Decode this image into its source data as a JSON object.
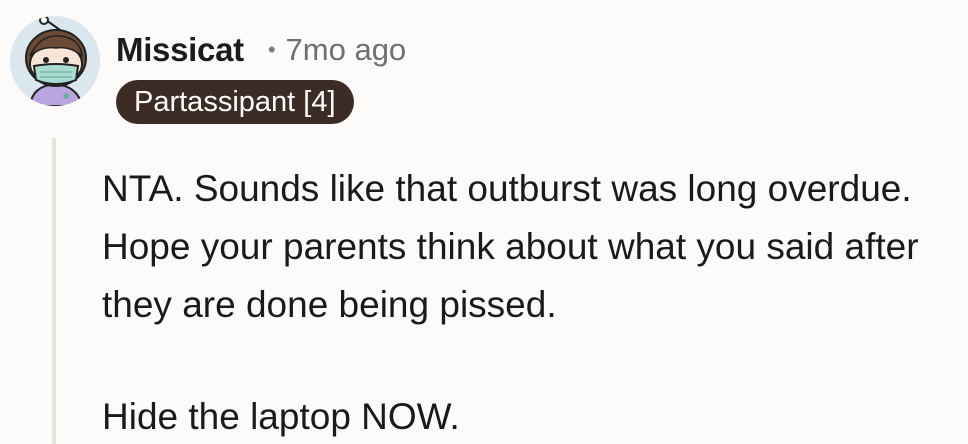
{
  "comment": {
    "author": "Missicat",
    "separator": "•",
    "timestamp": "7mo ago",
    "flair": "Partassipant [4]",
    "paragraphs": [
      "NTA. Sounds like that outburst was long overdue. Hope your parents think about what you said after they are done being pissed.",
      "Hide the laptop NOW."
    ]
  },
  "avatar": {
    "icon": "snoo-avatar-face-mask",
    "background_color": "#dbe7ef"
  },
  "colors": {
    "flair_background": "#3d2b25",
    "flair_text": "#ffffff",
    "page_background": "#fcfbfa",
    "thread_line": "#e6e3df"
  }
}
